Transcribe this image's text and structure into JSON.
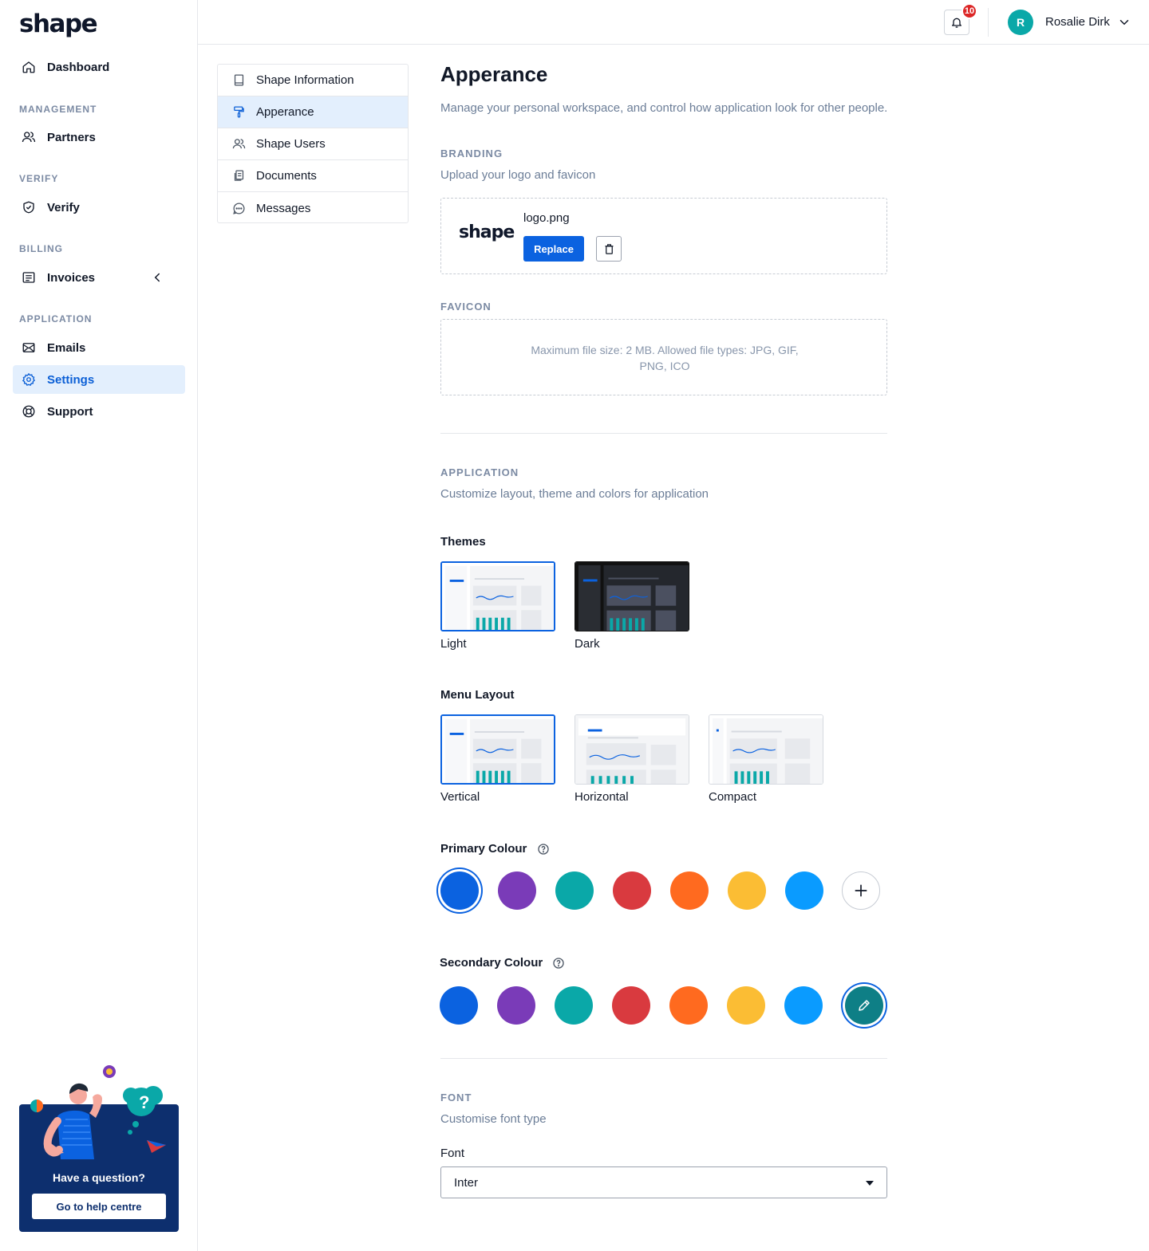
{
  "brand": {
    "name": "shape"
  },
  "sidebar": {
    "dashboard": "Dashboard",
    "management_label": "MANAGEMENT",
    "partners": "Partners",
    "verify_label": "VERIFY",
    "verify": "Verify",
    "billing_label": "BILLING",
    "invoices": "Invoices",
    "application_label": "APPLICATION",
    "emails": "Emails",
    "settings": "Settings",
    "support": "Support",
    "active_item": "Settings"
  },
  "help": {
    "title": "Have a question?",
    "button": "Go to help centre"
  },
  "header": {
    "notification_count": "10",
    "user_initial": "R",
    "user_name": "Rosalie Dirk"
  },
  "submenu": {
    "items": [
      "Shape Information",
      "Apperance",
      "Shape Users",
      "Documents",
      "Messages"
    ],
    "active": "Apperance"
  },
  "page": {
    "title": "Apperance",
    "subtitle": "Manage your personal workspace, and control how application look for other people."
  },
  "branding": {
    "label": "BRANDING",
    "subtitle": "Upload your logo and favicon",
    "logo_preview": "shape",
    "file_name": "logo.png",
    "replace": "Replace"
  },
  "favicon": {
    "label": "FAVICON",
    "note_line1": "Maximum file size: 2 MB. Allowed file types: JPG, GIF,",
    "note_line2": "PNG, ICO"
  },
  "application": {
    "label": "APPLICATION",
    "subtitle": "Customize layout, theme and colors for application",
    "themes_label": "Themes",
    "themes": [
      "Light",
      "Dark"
    ],
    "selected_theme": "Light",
    "menu_layout_label": "Menu Layout",
    "menu_layouts": [
      "Vertical",
      "Horizontal",
      "Compact"
    ],
    "selected_menu_layout": "Vertical",
    "primary_colour_label": "Primary Colour",
    "secondary_colour_label": "Secondary Colour",
    "colors": [
      "#0b62e0",
      "#7a3bb8",
      "#0aa8a8",
      "#d93a3f",
      "#ff6a1f",
      "#fbbd34",
      "#0a9bff"
    ],
    "custom_secondary_color": "#0e7f86",
    "selected_primary": "#0b62e0",
    "selected_secondary": "custom"
  },
  "font": {
    "label": "FONT",
    "subtitle": "Customise font type",
    "field_label": "Font",
    "value": "Inter"
  }
}
